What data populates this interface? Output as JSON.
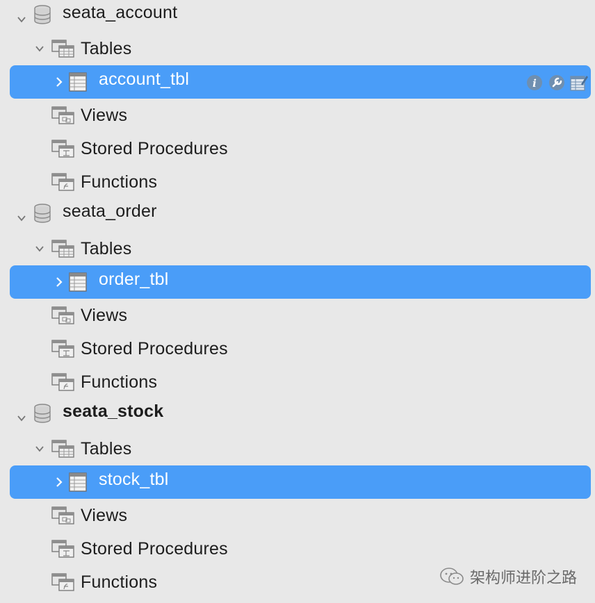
{
  "databases": [
    {
      "name": "seata_account",
      "bold": false,
      "tables_label": "Tables",
      "table": "account_tbl",
      "views_label": "Views",
      "procedures_label": "Stored Procedures",
      "functions_label": "Functions"
    },
    {
      "name": "seata_order",
      "bold": false,
      "tables_label": "Tables",
      "table": "order_tbl",
      "views_label": "Views",
      "procedures_label": "Stored Procedures",
      "functions_label": "Functions"
    },
    {
      "name": "seata_stock",
      "bold": true,
      "tables_label": "Tables",
      "table": "stock_tbl",
      "views_label": "Views",
      "procedures_label": "Stored Procedures",
      "functions_label": "Functions"
    }
  ],
  "row_actions": [
    "info-icon",
    "wrench-icon",
    "table-edit-icon"
  ],
  "watermark": {
    "text": "架构师进阶之路",
    "icon": "wechat-icon"
  },
  "colors": {
    "selection": "#4a9df8",
    "background": "#e8e8e8",
    "text": "#1d1d1d"
  }
}
